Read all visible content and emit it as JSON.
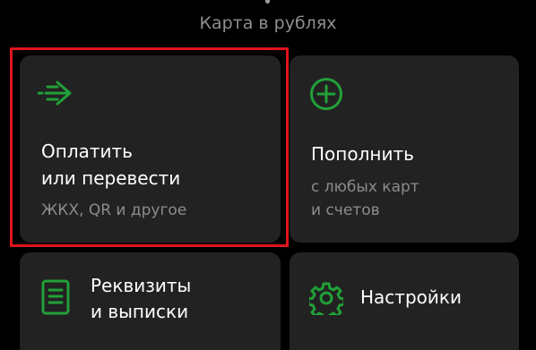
{
  "header": {
    "subtitle": "Карта в рублях"
  },
  "colors": {
    "background": "#000000",
    "tile": "#222222",
    "accent": "#21a038",
    "highlight": "#e0141b"
  },
  "actions": {
    "pay": {
      "icon": "transfer-arrow-icon",
      "title_line1": "Оплатить",
      "title_line2": "или перевести",
      "subtitle": "ЖКХ, QR и другое"
    },
    "topup": {
      "icon": "plus-circle-icon",
      "title": "Пополнить",
      "subtitle_line1": "с любых карт",
      "subtitle_line2": "и счетов"
    },
    "requisites": {
      "icon": "document-icon",
      "title_line1": "Реквизиты",
      "title_line2": "и выписки"
    },
    "settings": {
      "icon": "gear-icon",
      "title": "Настройки"
    }
  }
}
